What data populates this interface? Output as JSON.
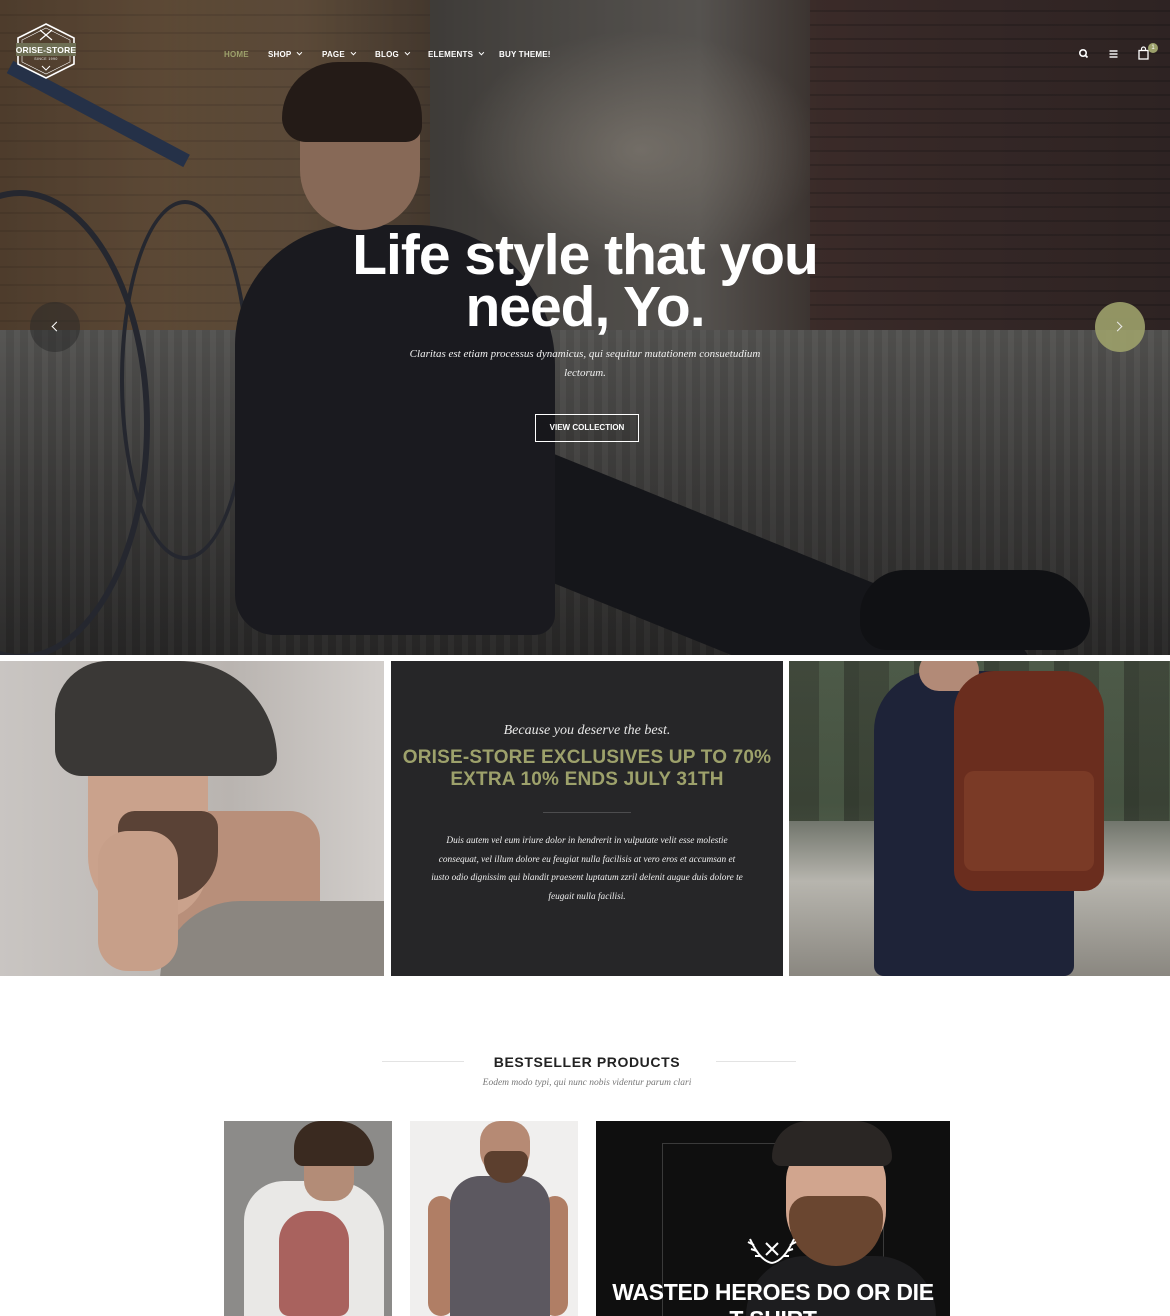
{
  "brand": {
    "name": "ORISE-STORE",
    "since": "SINCE 1990"
  },
  "nav": {
    "items": [
      {
        "label": "HOME",
        "active": true,
        "has_dropdown": false
      },
      {
        "label": "SHOP",
        "active": false,
        "has_dropdown": true
      },
      {
        "label": "PAGE",
        "active": false,
        "has_dropdown": true
      },
      {
        "label": "BLOG",
        "active": false,
        "has_dropdown": true
      },
      {
        "label": "ELEMENTS",
        "active": false,
        "has_dropdown": true
      },
      {
        "label": "BUY THEME!",
        "active": false,
        "has_dropdown": false
      }
    ]
  },
  "header_icons": [
    "search-icon",
    "menu-icon",
    "cart-icon"
  ],
  "cart": {
    "count": "1"
  },
  "hero": {
    "title": "Life style that you need, Yo.",
    "subtitle": "Claritas est etiam processus dynamicus, qui sequitur mutationem consuetudium lectorum.",
    "button": "VIEW COLLECTION"
  },
  "promo": {
    "script": "Because you deserve the best.",
    "title_line1": "ORISE-STORE EXCLUSIVES UP TO 70%",
    "title_line2": "EXTRA 10% ENDS JULY 31TH",
    "body": "Duis autem vel eum iriure dolor in hendrerit in vulputate velit esse molestie consequat, vel illum dolore eu feugiat nulla facilisis at vero eros et accumsan et iusto odio dignissim qui blandit praesent luptatum zzril delenit augue duis dolore te feugait nulla facilisi."
  },
  "bestseller": {
    "title": "BESTSELLER PRODUCTS",
    "subtitle": "Eodem modo typi, qui nunc nobis videntur parum clari"
  },
  "feature": {
    "title": "WASTED HEROES DO OR DIE",
    "title_partial": "T-SHIRT"
  },
  "colors": {
    "accent": "#9da16b",
    "dark_panel": "#262628",
    "text_dark": "#222222"
  }
}
